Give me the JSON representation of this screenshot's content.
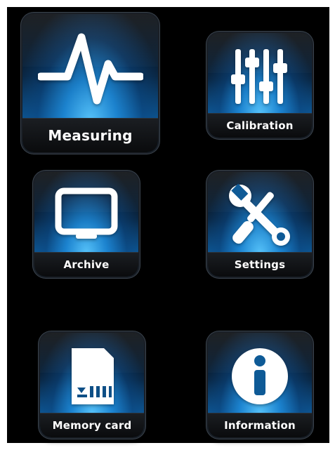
{
  "menu": {
    "measuring": {
      "label": "Measuring",
      "icon": "pulse-waveform-icon"
    },
    "calibration": {
      "label": "Calibration",
      "icon": "sliders-icon"
    },
    "archive": {
      "label": "Archive",
      "icon": "monitor-icon"
    },
    "settings": {
      "label": "Settings",
      "icon": "wrench-screwdriver-icon"
    },
    "memory_card": {
      "label": "Memory card",
      "icon": "memory-card-icon"
    },
    "information": {
      "label": "Information",
      "icon": "info-icon"
    }
  },
  "colors": {
    "background": "#000000",
    "tile_glow": "#2a9be8",
    "icon": "#ffffff",
    "label_bar": "#0f1114"
  }
}
